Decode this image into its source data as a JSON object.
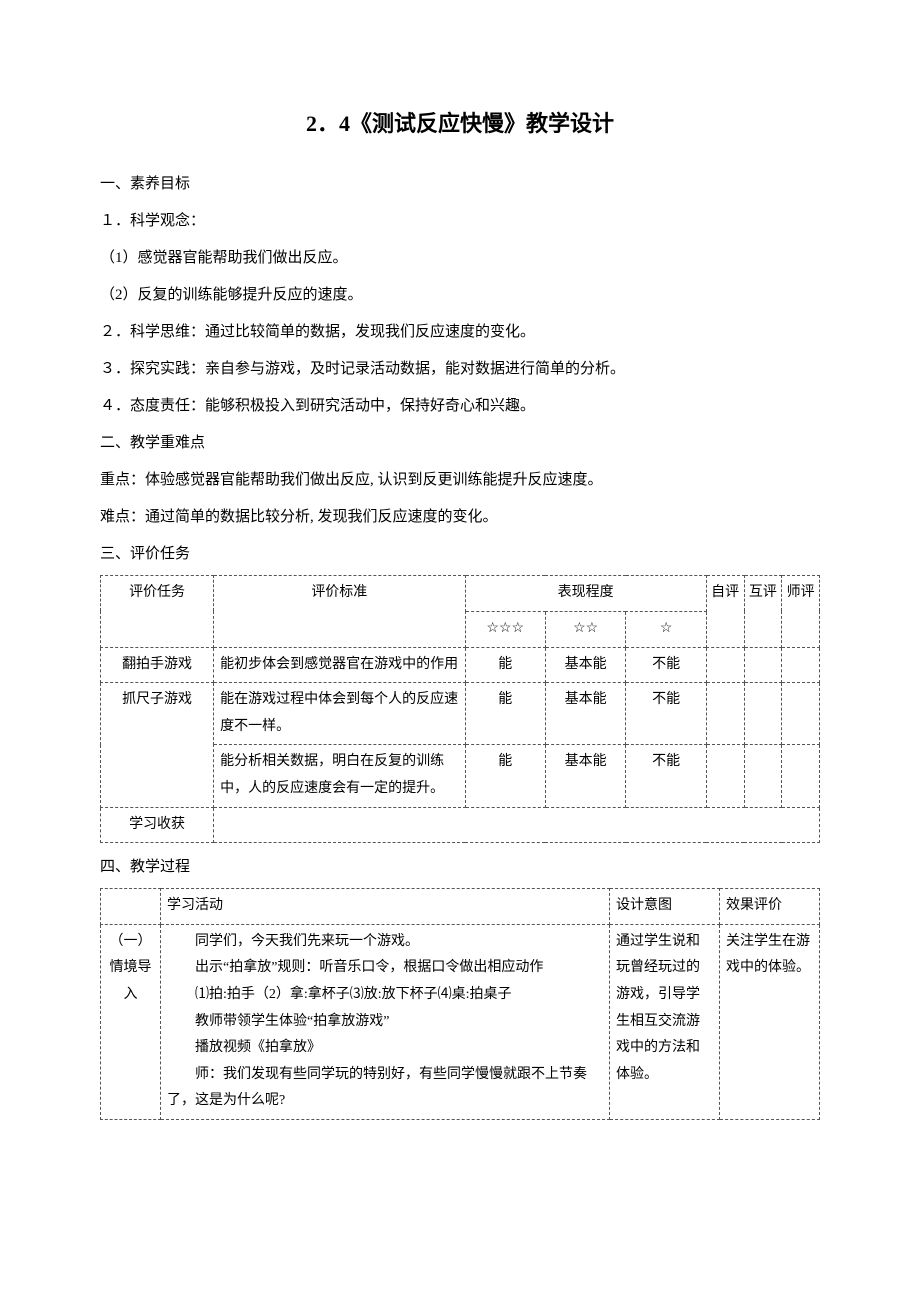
{
  "title": "2．4《测试反应快慢》教学设计",
  "s1": {
    "heading": "一、素养目标",
    "item1": "１．科学观念：",
    "sub1a": "（1）感觉器官能帮助我们做出反应。",
    "sub1b": "（2）反复的训练能够提升反应的速度。",
    "item2": "２．科学思维：通过比较简单的数据，发现我们反应速度的变化。",
    "item3": "３．探究实践：亲自参与游戏，及时记录活动数据，能对数据进行简单的分析。",
    "item4": "４．态度责任：能够积极投入到研究活动中，保持好奇心和兴趣。"
  },
  "s2": {
    "heading": "二、教学重难点",
    "key": "重点：体验感觉器官能帮助我们做出反应, 认识到反更训练能提升反应速度。",
    "diff": "难点：通过简单的数据比较分析, 发现我们反应速度的变化。"
  },
  "s3": {
    "heading": "三、评价任务",
    "th_task": "评价任务",
    "th_crit": "评价标准",
    "th_perf": "表现程度",
    "th_self": "自评",
    "th_peer": "互评",
    "th_tch": "师评",
    "star3": "☆☆☆",
    "star2": "☆☆",
    "star1": "☆",
    "r1_task": "翻拍手游戏",
    "r1_crit": "能初步体会到感觉器官在游戏中的作用",
    "r2_task": "抓尺子游戏",
    "r2_crit": "能在游戏过程中体会到每个人的反应速度不一样。",
    "r3_crit": "能分析相关数据，明白在反复的训练中，人的反应速度会有一定的提升。",
    "able": "能",
    "basic": "基本能",
    "unable": "不能",
    "r4_task": "学习收获"
  },
  "s4": {
    "heading": "四、教学过程",
    "th_act": "学习活动",
    "th_design": "设计意图",
    "th_eval": "效果评价",
    "sec1_label": "（一）情境导入",
    "act": "　　同学们，今天我们先来玩一个游戏。\n　　出示“拍拿放”规则：听音乐口令，根据口令做出相应动作\n　　⑴拍:拍手（2）拿:拿杯子⑶放:放下杯子⑷桌:拍桌子\n　　教师带领学生体验“拍拿放游戏”\n　　播放视频《拍拿放》\n　　师：我们发现有些同学玩的特别好，有些同学慢慢就跟不上节奏了，这是为什么呢?",
    "design": "通过学生说和玩曾经玩过的游戏，引导学生相互交流游戏中的方法和体验。",
    "eval": "关注学生在游戏中的体验。"
  }
}
